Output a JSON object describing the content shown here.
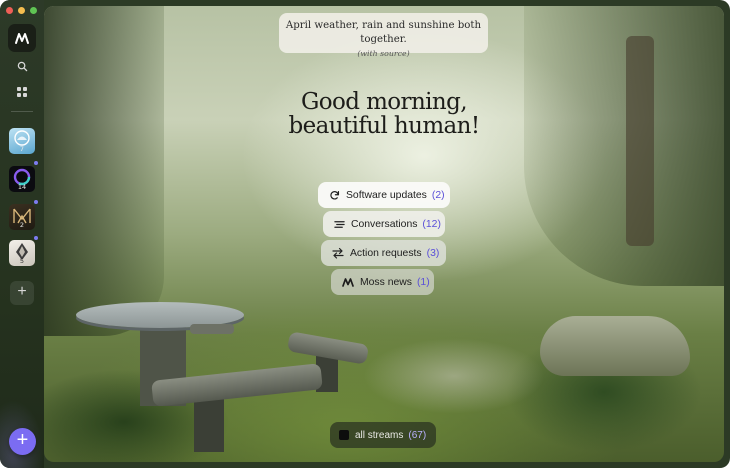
{
  "quote": {
    "text": "April weather, rain and sunshine both together.",
    "source": "(with source)"
  },
  "greeting": {
    "line1": "Good morning,",
    "line2": "beautiful human!"
  },
  "streams": [
    {
      "label": "Software updates",
      "count": "(2)",
      "icon": "refresh-icon"
    },
    {
      "label": "Conversations",
      "count": "(12)",
      "icon": "lines-icon"
    },
    {
      "label": "Action requests",
      "count": "(3)",
      "icon": "swap-arrows-icon"
    },
    {
      "label": "Moss news",
      "count": "(1)",
      "icon": "moss-logo-icon"
    }
  ],
  "all_streams": {
    "label": "all streams",
    "count": "(67)"
  },
  "sidebar": {
    "apps": [
      {
        "name": "app-1",
        "count": "7"
      },
      {
        "name": "app-2",
        "count": "14"
      },
      {
        "name": "app-3",
        "count": "2"
      },
      {
        "name": "app-4",
        "count": "5"
      }
    ],
    "add_label": "+",
    "fab_label": "+"
  },
  "colors": {
    "accent": "#7b6cf2",
    "count_text": "#5a4fd8"
  }
}
